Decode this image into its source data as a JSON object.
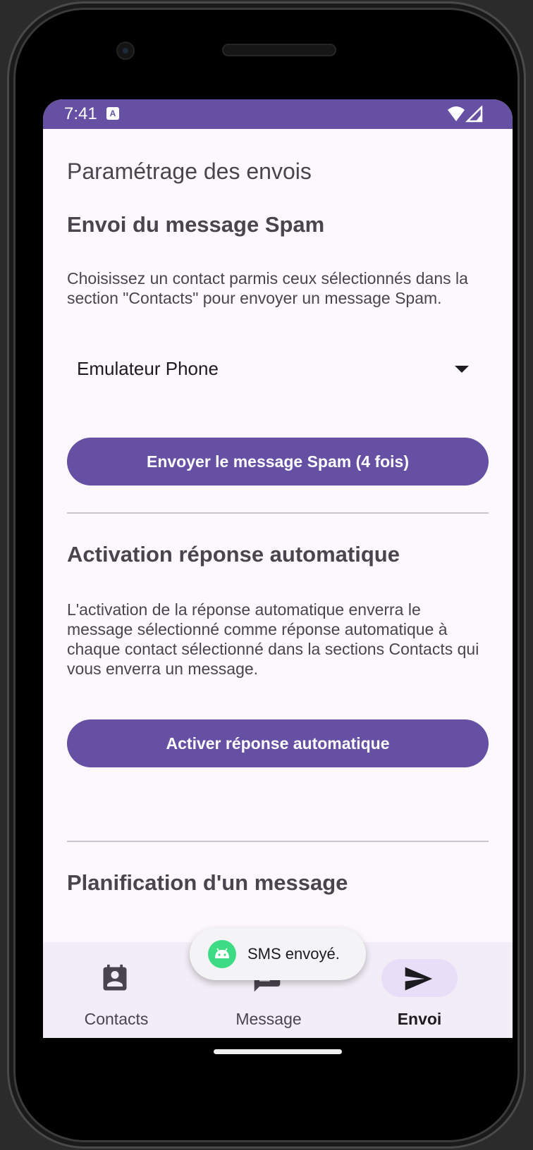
{
  "status_bar": {
    "time": "7:41",
    "notification_icon": "A",
    "icons": [
      "wifi-icon",
      "signal-icon"
    ]
  },
  "page": {
    "title": "Paramétrage des envois"
  },
  "spam_section": {
    "title": "Envoi du message Spam",
    "description": "Choisissez un contact parmis ceux sélectionnés dans la section \"Contacts\" pour envoyer un message Spam.",
    "contact_select_value": "Emulateur Phone",
    "button_label": "Envoyer le message Spam (4 fois)"
  },
  "auto_reply_section": {
    "title": "Activation réponse automatique",
    "description": "L'activation de la réponse automatique enverra le message sélectionné comme réponse automatique à chaque contact sélectionné dans la sections Contacts qui vous enverra un message.",
    "button_label": "Activer réponse automatique"
  },
  "schedule_section": {
    "title": "Planification d'un message"
  },
  "bottom_nav": {
    "items": [
      {
        "label": "Contacts",
        "icon": "contacts-icon",
        "active": false
      },
      {
        "label": "Message",
        "icon": "message-icon",
        "active": false
      },
      {
        "label": "Envoi",
        "icon": "send-icon",
        "active": true
      }
    ]
  },
  "toast": {
    "text": "SMS envoyé.",
    "icon": "android-icon"
  },
  "colors": {
    "primary": "#6650a4",
    "background": "#fdf8fe",
    "nav_background": "#f3edf7",
    "nav_indicator": "#e8def8",
    "text": "#49454f"
  }
}
